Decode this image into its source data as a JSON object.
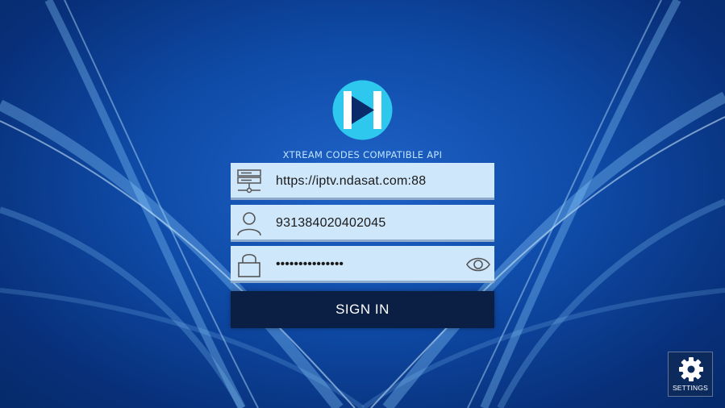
{
  "app": {
    "api_label": "XTREAM CODES COMPATIBLE API",
    "logo_icon": "play-logo-icon"
  },
  "form": {
    "server": {
      "icon": "server-icon",
      "value": "https://iptv.ndasat.com:88"
    },
    "username": {
      "icon": "user-icon",
      "value": "931384020402045"
    },
    "password": {
      "icon": "lock-icon",
      "value": "•••••••••••••••",
      "toggle_icon": "eye-icon"
    },
    "sign_in_label": "SIGN IN"
  },
  "settings": {
    "icon": "gear-icon",
    "label": "SETTINGS"
  },
  "colors": {
    "background": "#0e4aa6",
    "field_bg": "#cfe7fb",
    "button_bg": "#0b1f45",
    "accent_cyan": "#2ec7ee"
  }
}
